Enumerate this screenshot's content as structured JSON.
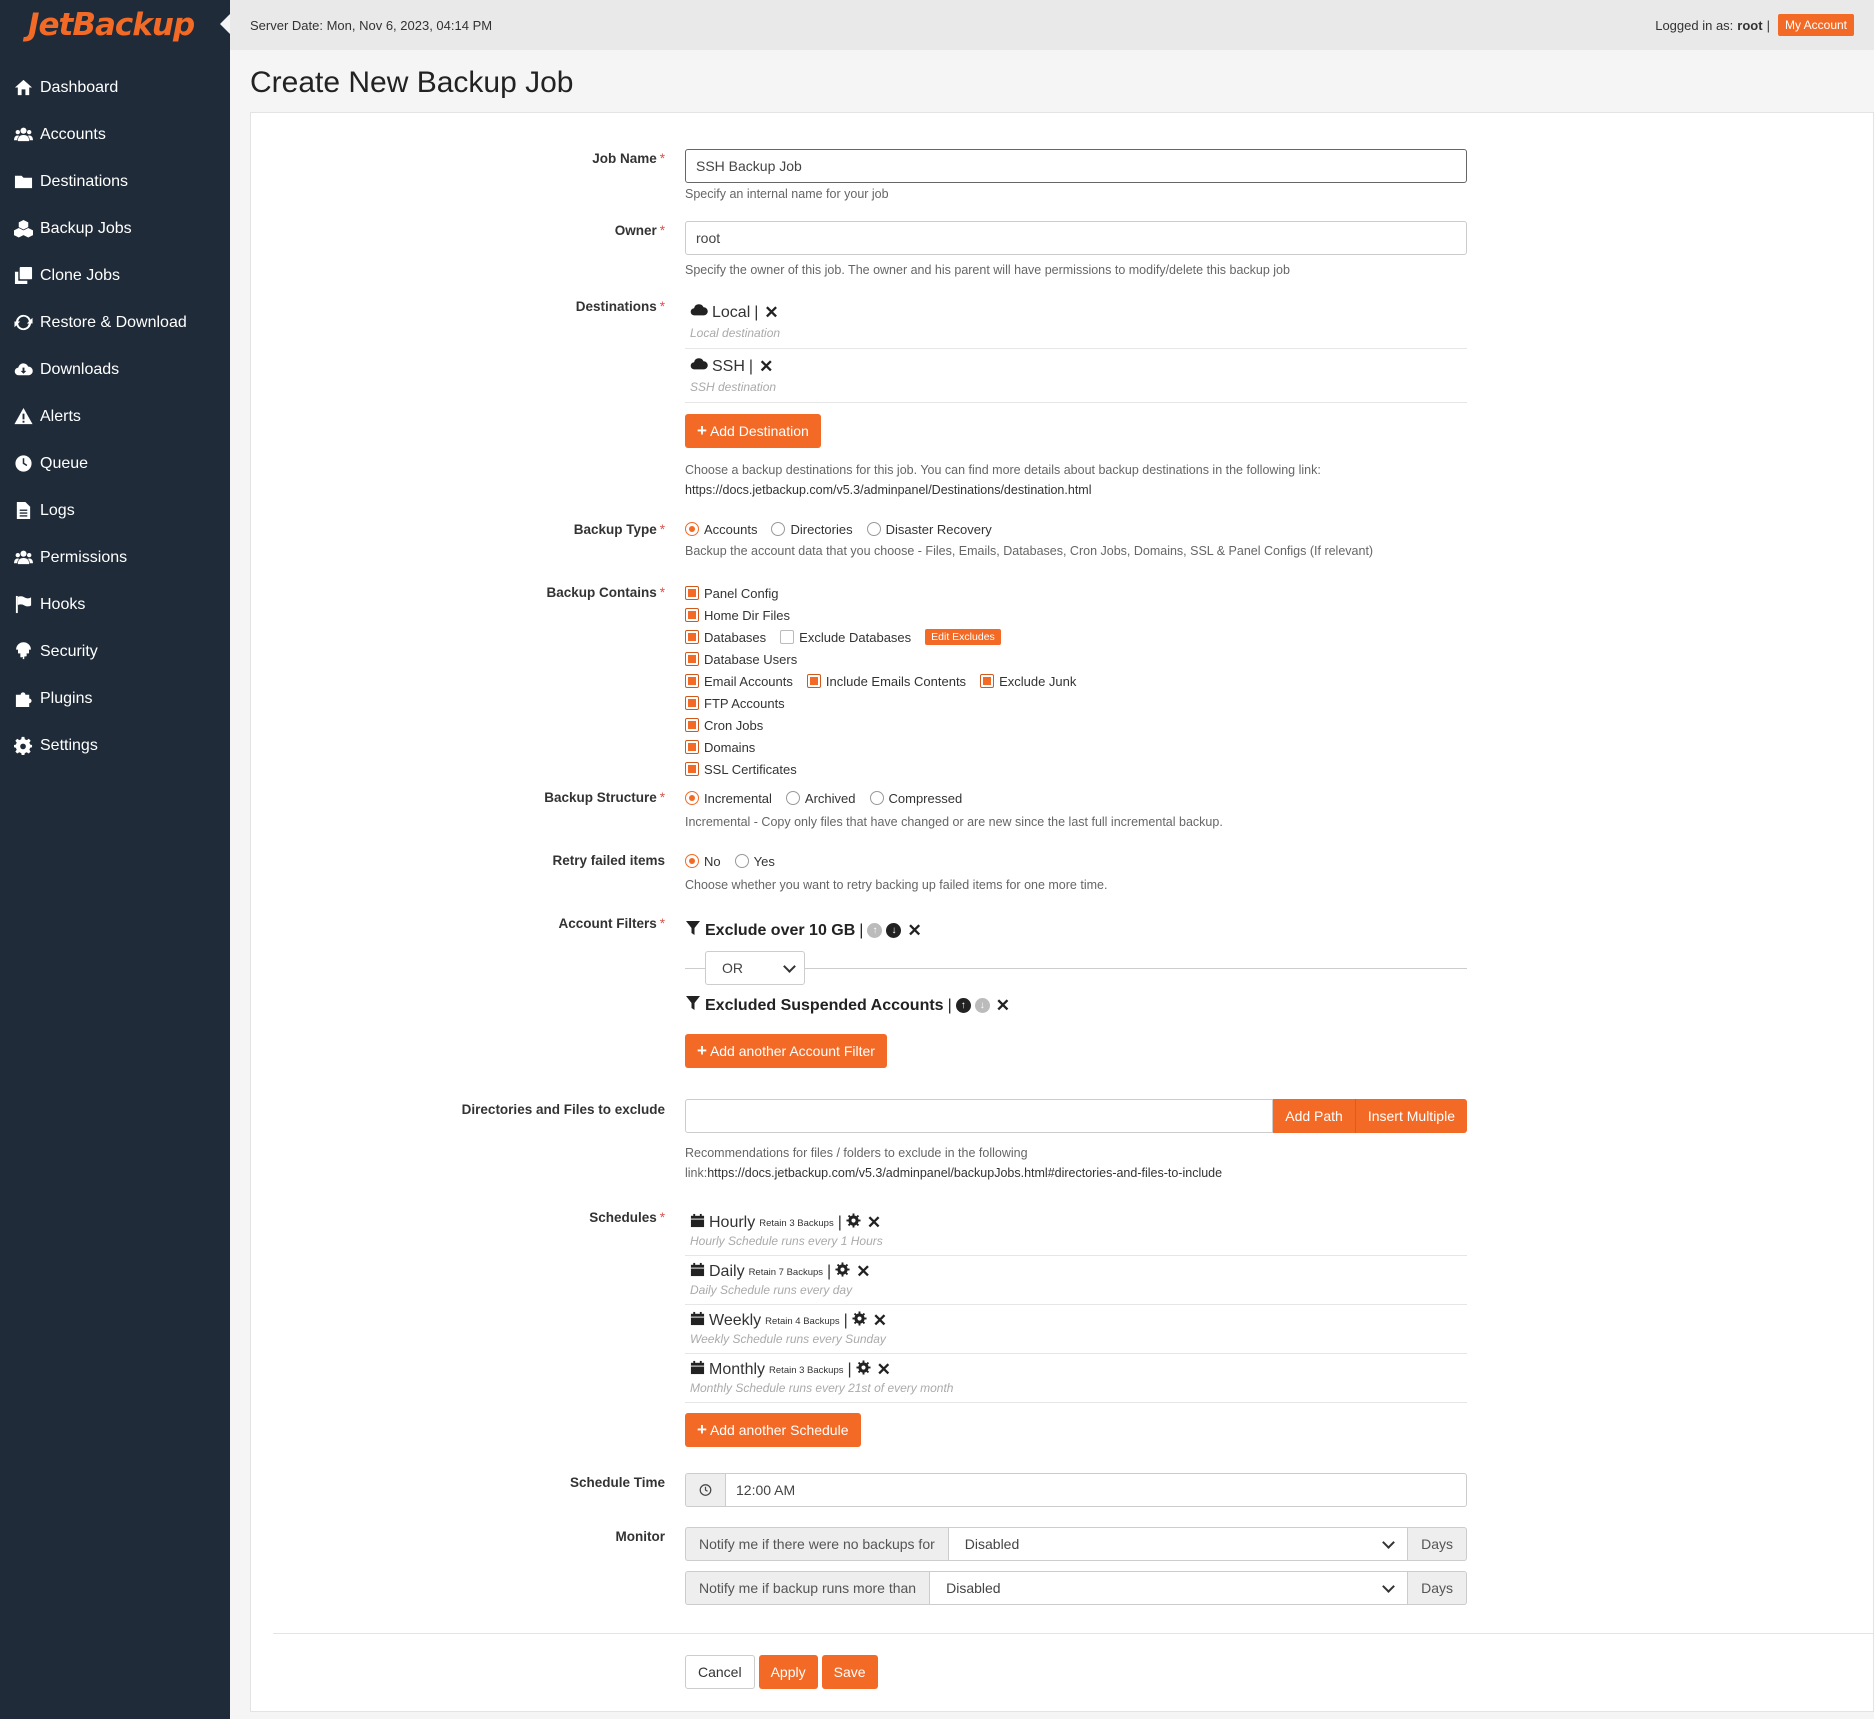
{
  "app": {
    "logo": "JetBackup"
  },
  "topbar": {
    "server_date": "Server Date: Mon, Nov 6, 2023, 04:14 PM",
    "logged_prefix": "Logged in as:",
    "user": "root",
    "sep": "|",
    "my_account": "My Account"
  },
  "sidebar": {
    "items": [
      {
        "label": "Dashboard",
        "icon": "home-icon"
      },
      {
        "label": "Accounts",
        "icon": "users-icon"
      },
      {
        "label": "Destinations",
        "icon": "folder-icon"
      },
      {
        "label": "Backup Jobs",
        "icon": "cubes-icon"
      },
      {
        "label": "Clone Jobs",
        "icon": "clone-icon"
      },
      {
        "label": "Restore & Download",
        "icon": "refresh-icon"
      },
      {
        "label": "Downloads",
        "icon": "cloud-download-icon"
      },
      {
        "label": "Alerts",
        "icon": "warning-icon"
      },
      {
        "label": "Queue",
        "icon": "clock-icon"
      },
      {
        "label": "Logs",
        "icon": "file-icon"
      },
      {
        "label": "Permissions",
        "icon": "users-icon"
      },
      {
        "label": "Hooks",
        "icon": "flag-icon"
      },
      {
        "label": "Security",
        "icon": "fingerprint-icon"
      },
      {
        "label": "Plugins",
        "icon": "puzzle-icon"
      },
      {
        "label": "Settings",
        "icon": "gear-icon"
      }
    ]
  },
  "page": {
    "title": "Create New Backup Job"
  },
  "form": {
    "job_name": {
      "label": "Job Name",
      "value": "SSH Backup Job",
      "help": "Specify an internal name for your job"
    },
    "owner": {
      "label": "Owner",
      "value": "root",
      "help": "Specify the owner of this job. The owner and his parent will have permissions to modify/delete this backup job"
    },
    "destinations": {
      "label": "Destinations",
      "items": [
        {
          "name": "Local",
          "sep": "|",
          "sub": "Local destination"
        },
        {
          "name": "SSH",
          "sep": "|",
          "sub": "SSH destination"
        }
      ],
      "add_button": "Add Destination",
      "help": "Choose a backup destinations for this job. You can find more details about backup destinations in the following link:",
      "link": "https://docs.jetbackup.com/v5.3/adminpanel/Destinations/destination.html"
    },
    "backup_type": {
      "label": "Backup Type",
      "options": [
        "Accounts",
        "Directories",
        "Disaster Recovery"
      ],
      "selected": "Accounts",
      "help": "Backup the account data that you choose - Files, Emails, Databases, Cron Jobs, Domains, SSL & Panel Configs (If relevant)"
    },
    "backup_contains": {
      "label": "Backup Contains",
      "panel_config": "Panel Config",
      "home_dir": "Home Dir Files",
      "databases": "Databases",
      "exclude_databases": "Exclude Databases",
      "edit_excludes": "Edit Excludes",
      "database_users": "Database Users",
      "email_accounts": "Email Accounts",
      "include_email_contents": "Include Emails Contents",
      "exclude_junk": "Exclude Junk",
      "ftp_accounts": "FTP Accounts",
      "cron_jobs": "Cron Jobs",
      "domains": "Domains",
      "ssl": "SSL Certificates"
    },
    "backup_structure": {
      "label": "Backup Structure",
      "options": [
        "Incremental",
        "Archived",
        "Compressed"
      ],
      "selected": "Incremental",
      "help": "Incremental - Copy only files that have changed or are new since the last full incremental backup."
    },
    "retry": {
      "label": "Retry failed items",
      "options": [
        "No",
        "Yes"
      ],
      "selected": "No",
      "help": "Choose whether you want to retry backing up failed items for one more time."
    },
    "account_filters": {
      "label": "Account Filters",
      "filters": [
        {
          "name": "Exclude over 10 GB",
          "sep": "|"
        },
        {
          "name": "Excluded Suspended Accounts",
          "sep": "|"
        }
      ],
      "operator": "OR",
      "add_button": "Add another Account Filter"
    },
    "exclude_paths": {
      "label": "Directories and Files to exclude",
      "value": "",
      "add_path": "Add Path",
      "insert_multiple": "Insert Multiple",
      "help": "Recommendations for files / folders to exclude in the following",
      "link_prefix": "link:",
      "link": "https://docs.jetbackup.com/v5.3/adminpanel/backupJobs.html#directories-and-files-to-include"
    },
    "schedules": {
      "label": "Schedules",
      "items": [
        {
          "name": "Hourly",
          "retain": "Retain 3 Backups",
          "sep": "|",
          "sub": "Hourly Schedule runs every 1 Hours"
        },
        {
          "name": "Daily",
          "retain": "Retain 7 Backups",
          "sep": "|",
          "sub": "Daily Schedule runs every day"
        },
        {
          "name": "Weekly",
          "retain": "Retain 4 Backups",
          "sep": "|",
          "sub": "Weekly Schedule runs every Sunday"
        },
        {
          "name": "Monthly",
          "retain": "Retain 3 Backups",
          "sep": "|",
          "sub": "Monthly Schedule runs every 21st of every month"
        }
      ],
      "add_button": "Add another Schedule"
    },
    "schedule_time": {
      "label": "Schedule Time",
      "value": "12:00 AM"
    },
    "monitor": {
      "label": "Monitor",
      "no_backups_prefix": "Notify me if there were no backups for",
      "no_backups_value": "Disabled",
      "runs_more_prefix": "Notify me if backup runs more than",
      "runs_more_value": "Disabled",
      "unit": "Days"
    }
  },
  "actions": {
    "cancel": "Cancel",
    "apply": "Apply",
    "save": "Save"
  },
  "colors": {
    "accent": "#f26a25",
    "sidebar": "#1f2b38"
  }
}
